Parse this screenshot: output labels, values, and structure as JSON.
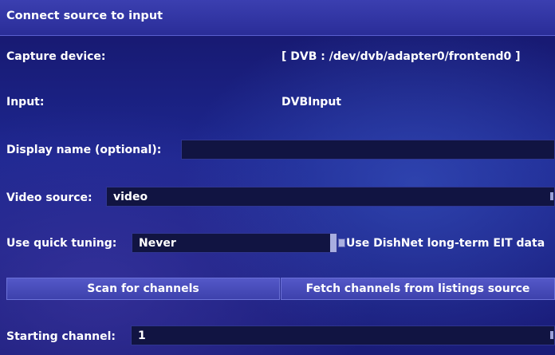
{
  "window": {
    "title": "Connect source to input"
  },
  "capture_device": {
    "label": "Capture device:",
    "value": "[ DVB : /dev/dvb/adapter0/frontend0 ]"
  },
  "input": {
    "label": "Input:",
    "value": "DVBInput"
  },
  "display_name": {
    "label": "Display name (optional):",
    "value": ""
  },
  "video_source": {
    "label": "Video source:",
    "value": "video"
  },
  "quick_tuning": {
    "label": "Use quick tuning:",
    "value": "Never"
  },
  "dishnet": {
    "label": "Use DishNet long-term EIT data",
    "checked": false
  },
  "buttons": {
    "scan": "Scan for channels",
    "fetch": "Fetch channels from listings source"
  },
  "starting_channel": {
    "label": "Starting channel:",
    "value": "1"
  }
}
